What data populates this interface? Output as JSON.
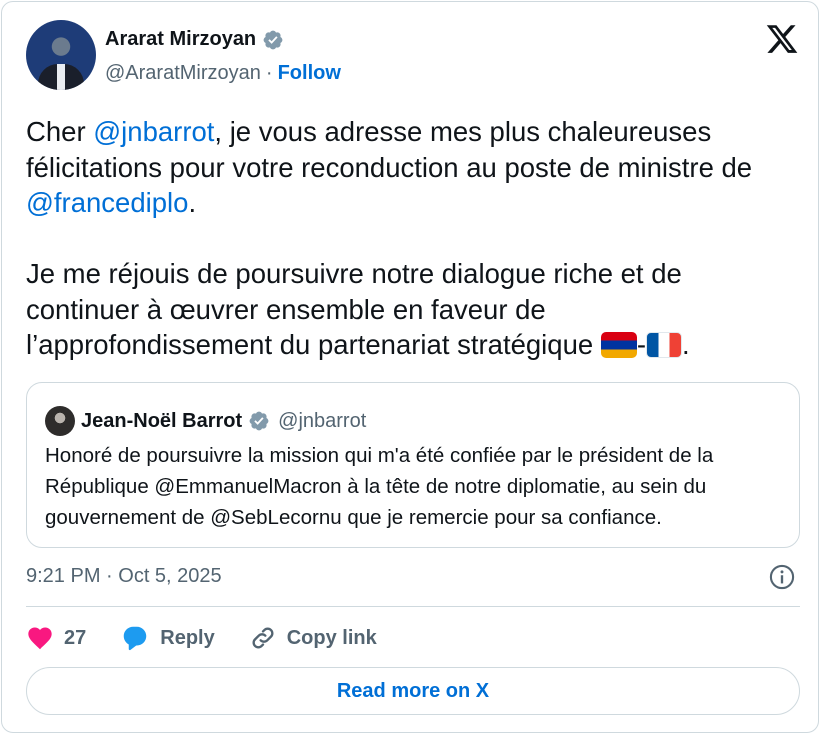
{
  "author": {
    "display_name": "Ararat Mirzoyan",
    "handle": "@AraratMirzoyan",
    "separator": "·",
    "follow_label": "Follow"
  },
  "tweet": {
    "p1": {
      "t1": "Cher ",
      "m1": "@jnbarrot",
      "t2": ", je vous adresse mes plus chaleureuses félicitations pour votre reconduction au poste de ministre de ",
      "m2": "@francediplo",
      "t3": "."
    },
    "p2": {
      "t1": "Je me réjouis de poursuivre notre dialogue riche et de continuer à œuvrer ensemble en faveur de l’approfondissement du partenariat stratégique ",
      "dash": "-",
      "end": "."
    },
    "flags": [
      "armenia-flag",
      "france-flag"
    ]
  },
  "quote": {
    "display_name": "Jean-Noël Barrot",
    "handle": "@jnbarrot",
    "text": "Honoré de poursuivre la mission qui m'a été confiée par le président de la République @EmmanuelMacron à la tête de notre diplomatie, au sein du gouvernement de @SebLecornu que je remercie pour sa confiance."
  },
  "meta": {
    "timestamp": "9:21 PM · Oct 5, 2025"
  },
  "actions": {
    "likes_count": "27",
    "reply_label": "Reply",
    "copy_link_label": "Copy link"
  },
  "read_more_label": "Read more on X",
  "colors": {
    "link": "#006fd6",
    "text": "#0f1419",
    "secondary": "#536471",
    "border": "#cfd9de",
    "heart": "#f91880",
    "verified": "#829aab"
  }
}
